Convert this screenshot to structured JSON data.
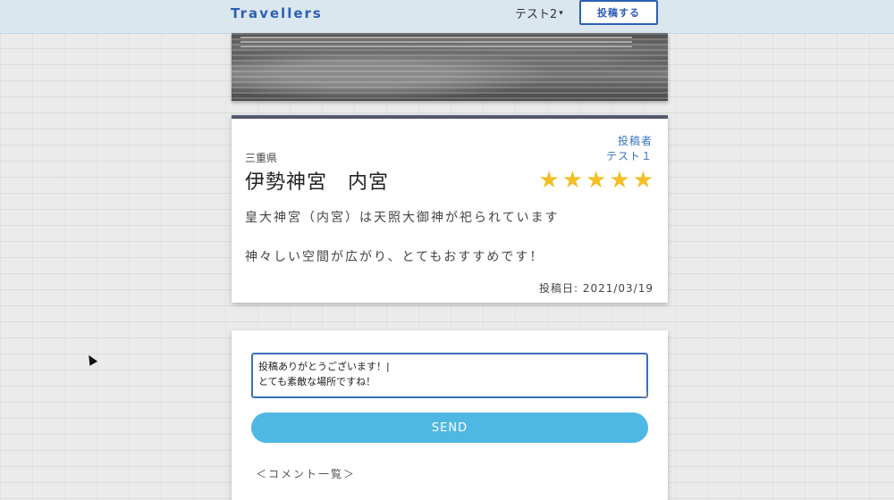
{
  "navbar": {
    "brand": "Travellers",
    "user_menu": "テスト2",
    "user_menu_caret": "▾",
    "post_button": "投稿する"
  },
  "post": {
    "author_label": "投稿者",
    "author_name": "テスト１",
    "prefecture": "三重県",
    "title": "伊勢神宮　内宮",
    "rating": 5,
    "star_glyph": "★",
    "description_line1": "皇大神宮（内宮）は天照大御神が祀られています",
    "description_line2": "神々しい空間が広がり、とてもおすすめです！",
    "posted_date": "投稿日: 2021/03/19"
  },
  "comment_form": {
    "value": "投稿ありがとうございます！|\nとても素敵な場所ですね！",
    "send_label": "SEND"
  },
  "comments": {
    "heading": "＜コメント一覧＞"
  },
  "colors": {
    "brand": "#2d5fb6",
    "star": "#f2bf26",
    "send_button": "#4fb7e3",
    "author_link": "#3a72c4"
  }
}
